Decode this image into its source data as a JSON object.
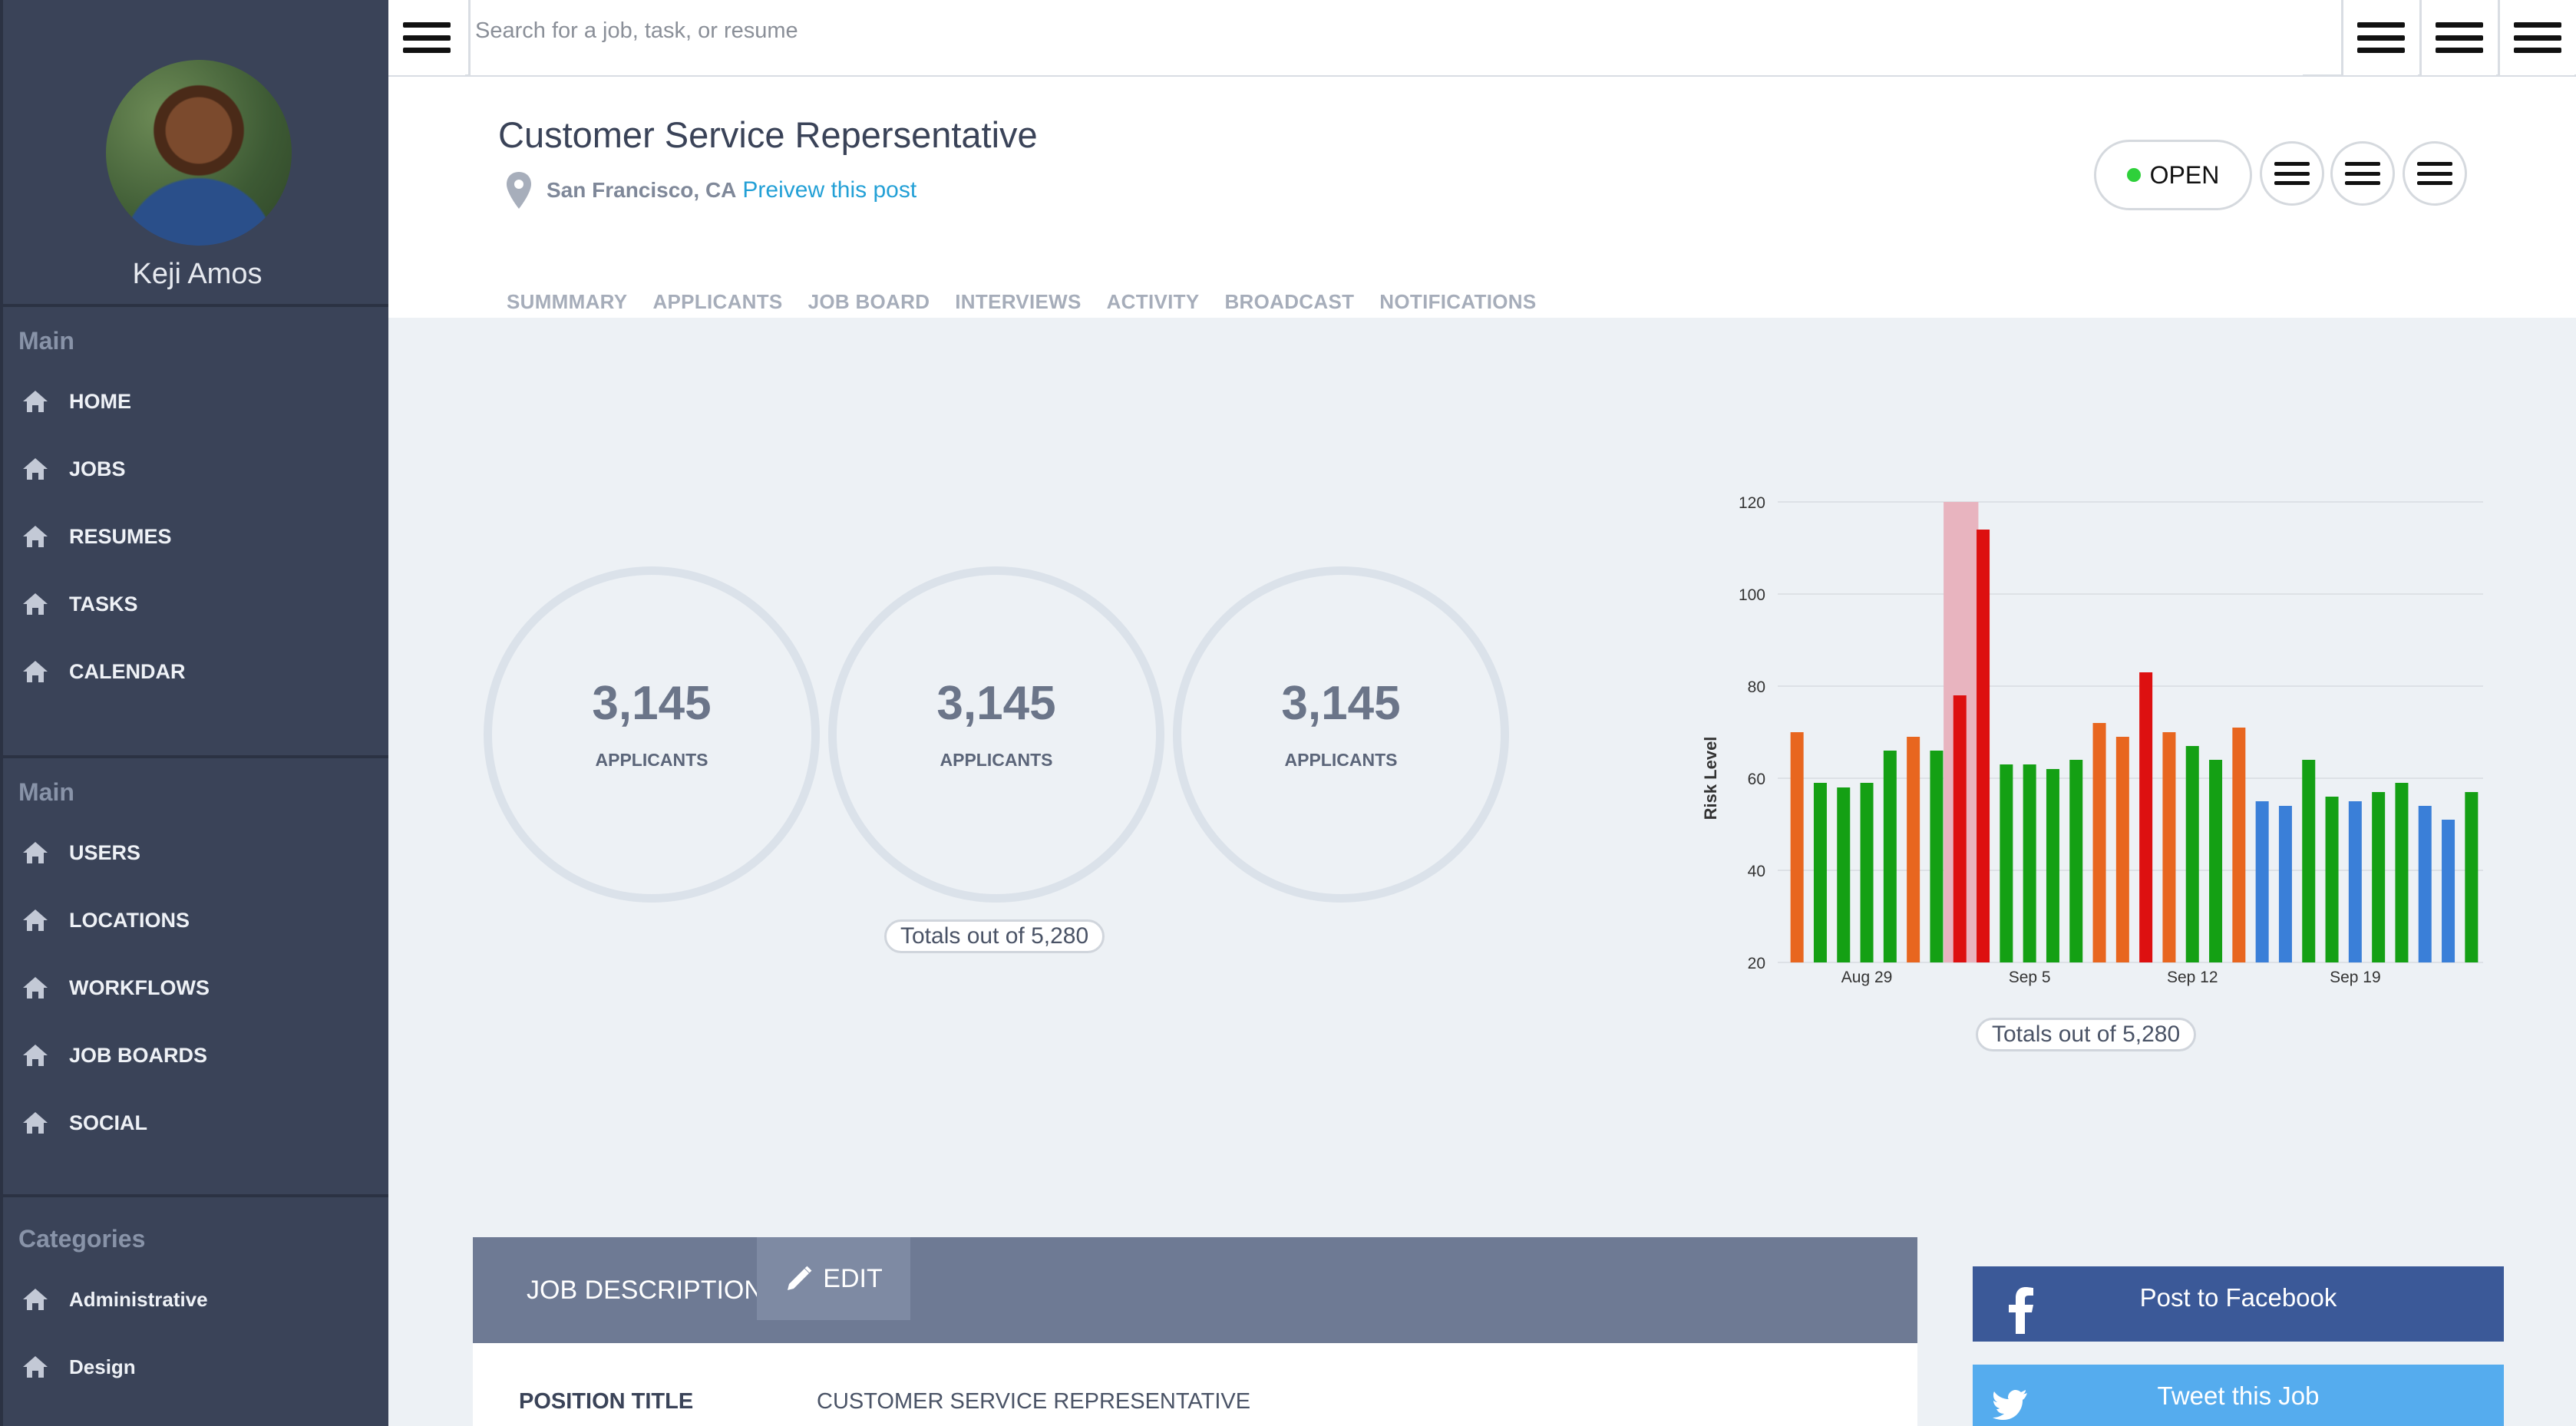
{
  "user": {
    "name": "Keji Amos"
  },
  "nav": {
    "section1": {
      "heading": "Main",
      "items": [
        "HOME",
        "JOBS",
        "RESUMES",
        "TASKS",
        "CALENDAR"
      ]
    },
    "section2": {
      "heading": "Main",
      "items": [
        "USERS",
        "LOCATIONS",
        "WORKFLOWS",
        "JOB BOARDS",
        "SOCIAL"
      ]
    },
    "section3": {
      "heading": "Categories",
      "items": [
        "Administrative",
        "Design"
      ]
    }
  },
  "search": {
    "placeholder": "Search for a job, task, or resume"
  },
  "job": {
    "title": "Customer Service Repersentative",
    "location": "San Francisco, CA",
    "preview_link": "Preivew this post",
    "status": "OPEN"
  },
  "tabs": [
    "SUMMMARY",
    "APPLICANTS",
    "JOB BOARD",
    "INTERVIEWS",
    "ACTIVITY",
    "BROADCAST",
    "NOTIFICATIONS"
  ],
  "stats": [
    {
      "value": "3,145",
      "label": "APPLICANTS"
    },
    {
      "value": "3,145",
      "label": "APPLICANTS"
    },
    {
      "value": "3,145",
      "label": "APPLICANTS"
    }
  ],
  "totals_text": "Totals out of 5,280",
  "chart_totals_text": "Totals out of 5,280",
  "colors": {
    "green": "#14a014",
    "orange": "#e8661f",
    "red": "#dd1010",
    "blue": "#3a7fd8",
    "highlight": "#e8b4bf",
    "status_dot": "#2ed03a"
  },
  "chart_data": {
    "type": "bar",
    "ylabel": "Risk Level",
    "ylim": [
      20,
      120
    ],
    "yticks": [
      20,
      40,
      60,
      80,
      100,
      120
    ],
    "xticks": [
      {
        "label": "Aug 29",
        "index": 3
      },
      {
        "label": "Sep 5",
        "index": 10
      },
      {
        "label": "Sep 12",
        "index": 17
      },
      {
        "label": "Sep 19",
        "index": 24
      }
    ],
    "highlight_index": 7,
    "bars": [
      {
        "value": 70,
        "color": "orange"
      },
      {
        "value": 59,
        "color": "green"
      },
      {
        "value": 58,
        "color": "green"
      },
      {
        "value": 59,
        "color": "green"
      },
      {
        "value": 66,
        "color": "green"
      },
      {
        "value": 69,
        "color": "orange"
      },
      {
        "value": 66,
        "color": "green"
      },
      {
        "value": 78,
        "color": "red"
      },
      {
        "value": 114,
        "color": "red"
      },
      {
        "value": 63,
        "color": "green"
      },
      {
        "value": 63,
        "color": "green"
      },
      {
        "value": 62,
        "color": "green"
      },
      {
        "value": 64,
        "color": "green"
      },
      {
        "value": 72,
        "color": "orange"
      },
      {
        "value": 69,
        "color": "orange"
      },
      {
        "value": 83,
        "color": "red"
      },
      {
        "value": 70,
        "color": "orange"
      },
      {
        "value": 67,
        "color": "green"
      },
      {
        "value": 64,
        "color": "green"
      },
      {
        "value": 71,
        "color": "orange"
      },
      {
        "value": 55,
        "color": "blue"
      },
      {
        "value": 54,
        "color": "blue"
      },
      {
        "value": 64,
        "color": "green"
      },
      {
        "value": 56,
        "color": "green"
      },
      {
        "value": 55,
        "color": "blue"
      },
      {
        "value": 57,
        "color": "green"
      },
      {
        "value": 59,
        "color": "green"
      },
      {
        "value": 54,
        "color": "blue"
      },
      {
        "value": 51,
        "color": "blue"
      },
      {
        "value": 57,
        "color": "green"
      }
    ]
  },
  "job_description": {
    "heading": "JOB DESCRIPTION",
    "edit_label": "EDIT",
    "position_label": "POSITION TITLE",
    "position_value": "CUSTOMER SERVICE REPRESENTATIVE"
  },
  "social": {
    "facebook_label": "Post to Facebook",
    "twitter_label": "Tweet this Job"
  }
}
